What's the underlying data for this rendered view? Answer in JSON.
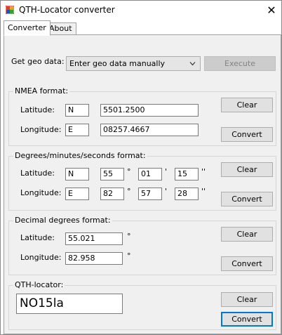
{
  "window": {
    "title": "QTH-Locator converter"
  },
  "tabs": [
    {
      "label": "Converter"
    },
    {
      "label": "About"
    }
  ],
  "geo": {
    "label": "Get geo data:",
    "source_value": "Enter geo data manually",
    "execute_label": "Execute"
  },
  "nmea": {
    "legend": "NMEA format:",
    "lat_label": "Latitude:",
    "lat_hemi": "N",
    "lat_value": "5501.2500",
    "lon_label": "Longitude:",
    "lon_hemi": "E",
    "lon_value": "08257.4667",
    "clear_label": "Clear",
    "convert_label": "Convert"
  },
  "dms": {
    "legend": "Degrees/minutes/seconds format:",
    "lat_label": "Latitude:",
    "lat_hemi": "N",
    "lat_deg": "55",
    "lat_min": "01",
    "lat_sec": "15",
    "lon_label": "Longitude:",
    "lon_hemi": "E",
    "lon_deg": "82",
    "lon_min": "57",
    "lon_sec": "28",
    "deg_symbol": "°",
    "min_symbol": "'",
    "sec_symbol": "''",
    "clear_label": "Clear",
    "convert_label": "Convert"
  },
  "decimal": {
    "legend": "Decimal degrees format:",
    "lat_label": "Latitude:",
    "lat_value": "55.021",
    "lon_label": "Longitude:",
    "lon_value": "82.958",
    "deg_symbol": "°",
    "clear_label": "Clear",
    "convert_label": "Convert"
  },
  "qth": {
    "legend": "QTH-locator:",
    "value": "NO15la",
    "clear_label": "Clear",
    "convert_label": "Convert"
  }
}
